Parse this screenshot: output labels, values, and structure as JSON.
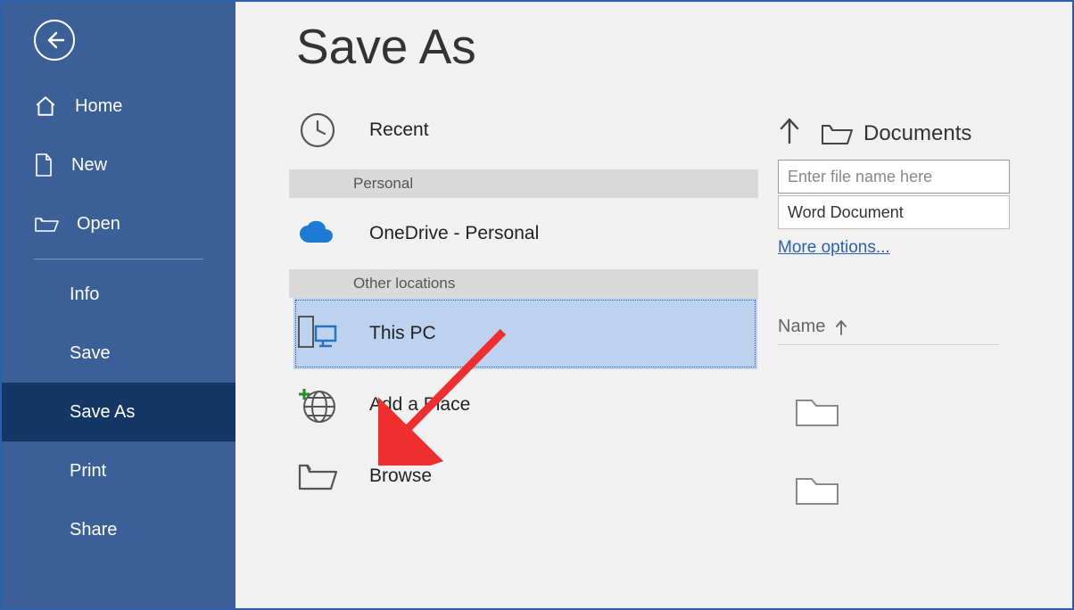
{
  "sidebar": {
    "items": [
      {
        "label": "Home"
      },
      {
        "label": "New"
      },
      {
        "label": "Open"
      },
      {
        "label": "Info"
      },
      {
        "label": "Save"
      },
      {
        "label": "Save As"
      },
      {
        "label": "Print"
      },
      {
        "label": "Share"
      }
    ]
  },
  "main": {
    "title": "Save As"
  },
  "locations": {
    "recent": "Recent",
    "personal_header": "Personal",
    "onedrive": "OneDrive - Personal",
    "other_header": "Other locations",
    "this_pc": "This PC",
    "add_place": "Add a Place",
    "browse": "Browse"
  },
  "right": {
    "current_folder": "Documents",
    "filename_placeholder": "Enter file name here",
    "filetype": "Word Document",
    "more_options": "More options...",
    "column_header": "Name"
  }
}
